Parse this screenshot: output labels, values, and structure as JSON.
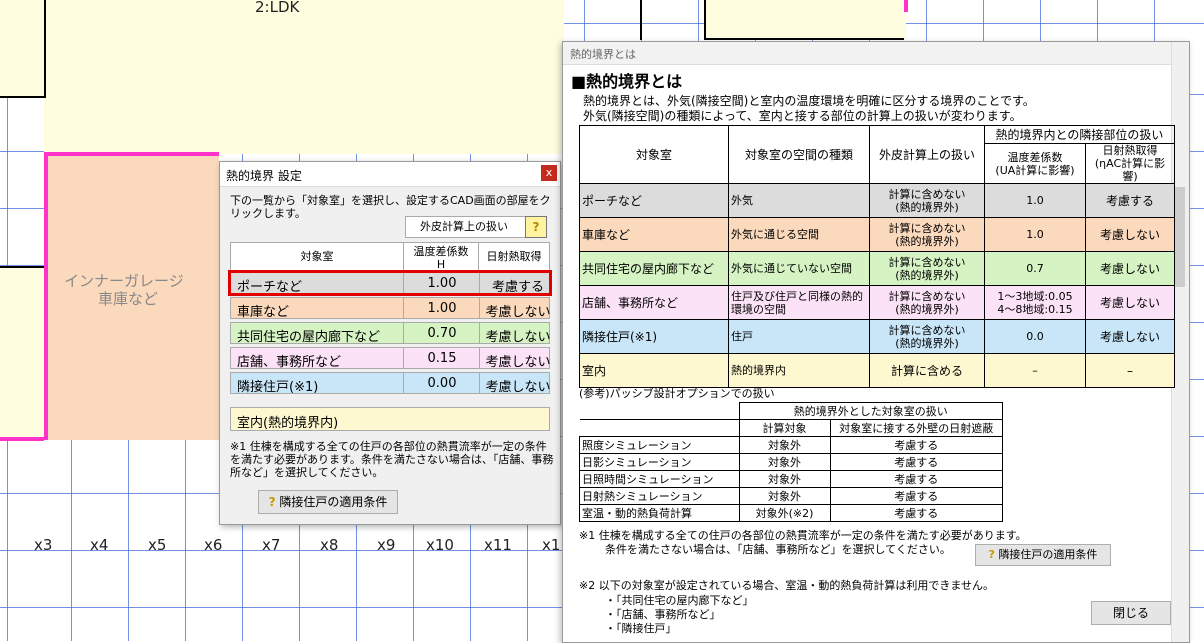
{
  "cad": {
    "room_top_label": "2:LDK",
    "garage_label_1": "インナーガレージ",
    "garage_label_2": "車庫など",
    "axis_ticks": [
      "x3",
      "x4",
      "x5",
      "x6",
      "x7",
      "x8",
      "x9",
      "x10",
      "x11",
      "x1"
    ]
  },
  "small_dialog": {
    "title": "熱的境界 設定",
    "close": "x",
    "description": "下の一覧から「対象室」を選択し、設定するCAD画面の部屋をクリックします。",
    "outer_calc_label": "外皮計算上の扱い",
    "help_button": "?",
    "columns": {
      "room": "対象室",
      "temp_coef_1": "温度差係数",
      "temp_coef_2": "H",
      "solar": "日射熱取得"
    },
    "rows": [
      {
        "room": "ポーチなど",
        "coef": "1.00",
        "solar": "考慮する",
        "color": "#dcdcdc"
      },
      {
        "room": "車庫など",
        "coef": "1.00",
        "solar": "考慮しない",
        "color": "#fbd9bd"
      },
      {
        "room": "共同住宅の屋内廊下など",
        "coef": "0.70",
        "solar": "考慮しない",
        "color": "#d6f3c4"
      },
      {
        "room": "店舗、事務所など",
        "coef": "0.15",
        "solar": "考慮しない",
        "color": "#fbe2f6"
      },
      {
        "room": "隣接住戸(※1)",
        "coef": "0.00",
        "solar": "考慮しない",
        "color": "#c9e6f8"
      }
    ],
    "inside_row": "室内(熱的境界内)",
    "note": "※1 住棟を構成する全ての住戸の各部位の熱貫流率が一定の条件を満たす必要があります。条件を満たさない場合は、「店舗、事務所など」を選択してください。",
    "adjacent_button": "隣接住戸の適用条件"
  },
  "big_dialog": {
    "title": "熱的境界とは",
    "heading": "■熱的境界とは",
    "intro_1": "熱的境界とは、外気(隣接空間)と室内の温度環境を明確に区分する境界のことです。",
    "intro_2": "外気(隣接空間)の種類によって、室内と接する部位の計算上の扱いが変わります。",
    "table_headers": {
      "room": "対象室",
      "space_type": "対象室の空間の種類",
      "outer_calc": "外皮計算上の扱い",
      "adjacent": "熱的境界内との隣接部位の扱い",
      "temp_coef": "温度差係数",
      "temp_coef_sub": "(UA計算に影響)",
      "solar": "日射熱取得",
      "solar_sub": "(ηAC計算に影響)"
    },
    "rows": [
      {
        "room": "ポーチなど",
        "space": "外気",
        "calc1": "計算に含めない",
        "calc2": "(熱的境界外)",
        "coef": "1.0",
        "solar": "考慮する",
        "color": "#dcdcdc"
      },
      {
        "room": "車庫など",
        "space": "外気に通じる空間",
        "calc1": "計算に含めない",
        "calc2": "(熱的境界外)",
        "coef": "1.0",
        "solar": "考慮しない",
        "color": "#fbd9bd"
      },
      {
        "room": "共同住宅の屋内廊下など",
        "space": "外気に通じていない空間",
        "calc1": "計算に含めない",
        "calc2": "(熱的境界外)",
        "coef": "0.7",
        "solar": "考慮しない",
        "color": "#d6f3c4"
      },
      {
        "room": "店舗、事務所など",
        "space": "住戸及び住戸と同様の熱的環境の空間",
        "calc1": "計算に含めない",
        "calc2": "(熱的境界外)",
        "coef": "1〜3地域:0.05 4〜8地域:0.15",
        "solar": "考慮しない",
        "color": "#fbe2f6"
      },
      {
        "room": "隣接住戸(※1)",
        "space": "住戸",
        "calc1": "計算に含めない",
        "calc2": "(熱的境界外)",
        "coef": "0.0",
        "solar": "考慮しない",
        "color": "#c9e6f8"
      },
      {
        "room": "室内",
        "space": "熱的境界内",
        "calc1": "計算に含める",
        "calc2": "",
        "coef": "–",
        "solar": "–",
        "color": "#fdf8cf"
      }
    ],
    "ref_title": "(参考)パッシブ設計オプションでの扱い",
    "ref_headers": {
      "group": "熱的境界外とした対象室の扱い",
      "calc_target": "計算対象",
      "wall_solar": "対象室に接する外壁の日射遮蔽"
    },
    "ref_rows": [
      {
        "name": "照度シミュレーション",
        "target": "対象外",
        "solar": "考慮する"
      },
      {
        "name": "日影シミュレーション",
        "target": "対象外",
        "solar": "考慮する"
      },
      {
        "name": "日照時間シミュレーション",
        "target": "対象外",
        "solar": "考慮する"
      },
      {
        "name": "日射熱シミュレーション",
        "target": "対象外",
        "solar": "考慮する"
      },
      {
        "name": "室温・動的熱負荷計算",
        "target": "対象外(※2)",
        "solar": "考慮する"
      }
    ],
    "note1_a": "※1 住棟を構成する全ての住戸の各部位の熱貫流率が一定の条件を満たす必要があります。",
    "note1_b": "条件を満たさない場合は、「店舗、事務所など」を選択してください。",
    "adjacent_button": "隣接住戸の適用条件",
    "note2": "※2 以下の対象室が設定されている場合、室温・動的熱負荷計算は利用できません。",
    "note2_items": [
      "・「共同住宅の屋内廊下など」",
      "・「店舗、事務所など」",
      "・「隣接住戸」"
    ],
    "close_button": "閉じる"
  }
}
